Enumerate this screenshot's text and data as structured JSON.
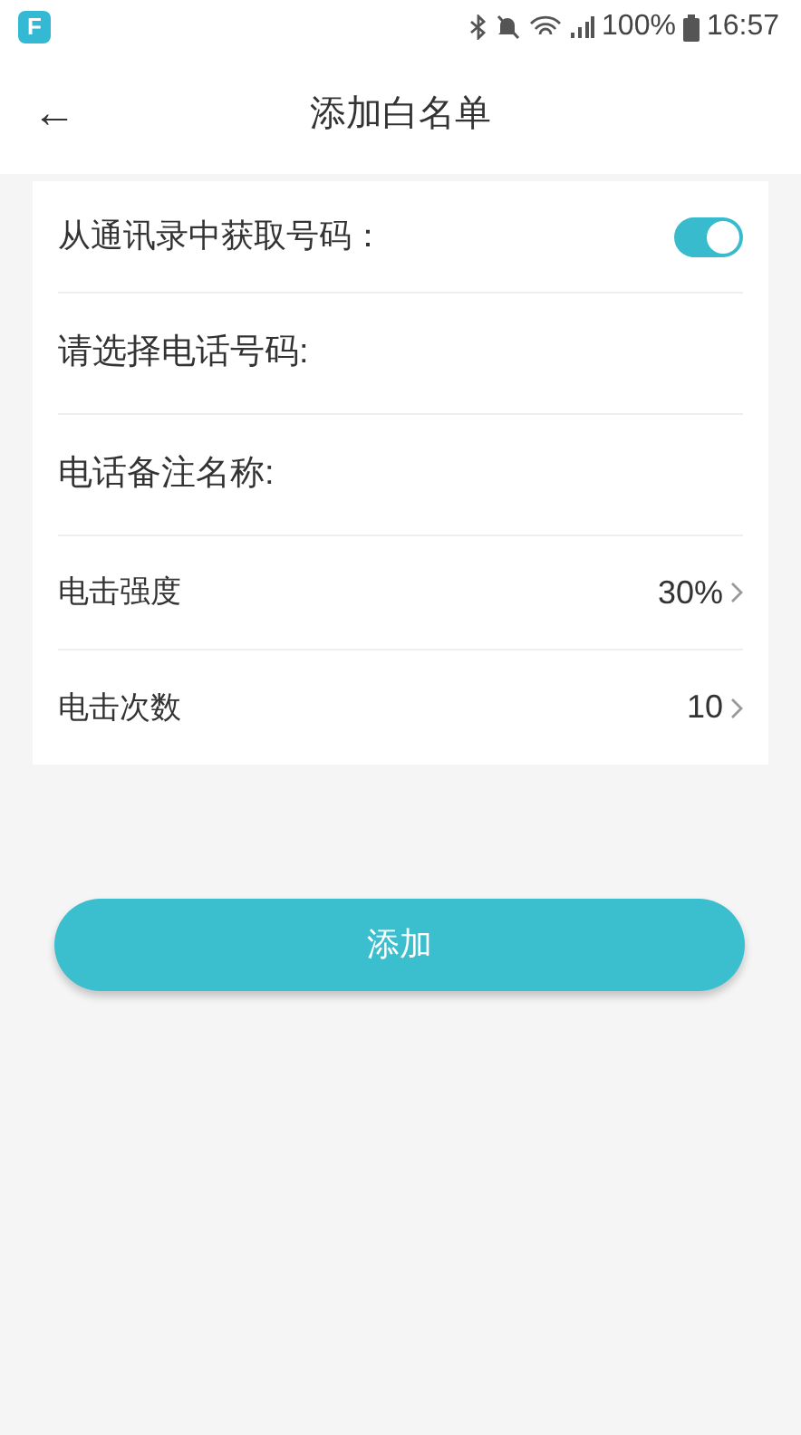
{
  "status_bar": {
    "app_icon": "F",
    "battery": "100%",
    "time": "16:57"
  },
  "header": {
    "back": "←",
    "title": "添加白名单"
  },
  "rows": [
    {
      "kind": "switch",
      "label": "从通讯录中获取号码：",
      "on": true
    },
    {
      "kind": "field",
      "label": "请选择电话号码:"
    },
    {
      "kind": "field",
      "label": "电话备注名称:"
    },
    {
      "kind": "select",
      "label": "电击强度",
      "value": "30%"
    },
    {
      "kind": "select",
      "label": "电击次数",
      "value": "10"
    }
  ],
  "submit_button": "添加"
}
